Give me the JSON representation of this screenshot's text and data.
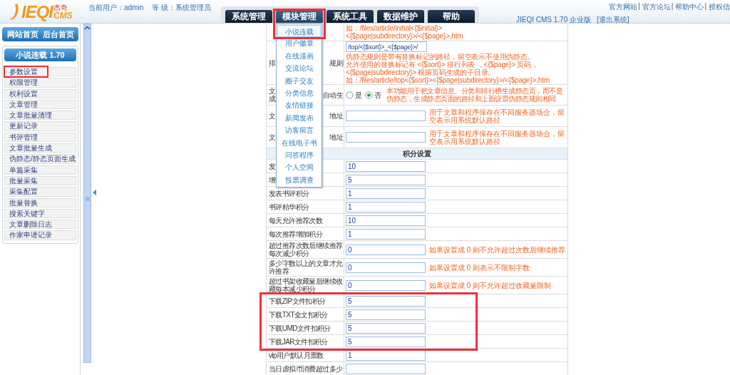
{
  "header": {
    "logo": {
      "text": "IEQI",
      "badge": "杰奇",
      "sub": "CMS"
    },
    "user": "当前用户：admin",
    "level": "等 级：系统管理员",
    "tabs": [
      {
        "label": "系统管理",
        "selected": false
      },
      {
        "label": "模块管理",
        "selected": true
      },
      {
        "label": "系统工具",
        "selected": false
      },
      {
        "label": "数据维护",
        "selected": false
      },
      {
        "label": "帮助",
        "selected": false
      }
    ],
    "links": [
      {
        "text": "官方网站",
        "sep": "|"
      },
      {
        "text": "官方论坛",
        "sep": "|"
      },
      {
        "text": "帮助中心",
        "sep": "|"
      },
      {
        "text": "授权信"
      }
    ],
    "version": "JIEQI CMS 1.70 企业版",
    "logout": "[退出系统]"
  },
  "sidebar": {
    "home_links": [
      "网站首页",
      "后台首页"
    ],
    "module_title": "小说连载 1.70",
    "items": [
      "参数设置",
      "权限管理",
      "权利设置",
      "文章管理",
      "文章批量清理",
      "更新记录",
      "书评管理",
      "文章批量生成",
      "伪静态/静态页面生成",
      "单篇采集",
      "批量采集",
      "采集配置",
      "批量替换",
      "搜索关键字",
      "文章删除日志",
      "作家申请记录"
    ]
  },
  "menu": {
    "items": [
      {
        "label": "小说连载",
        "selected": true
      },
      {
        "label": "用户徽章",
        "selected": false
      },
      {
        "label": "在线漫画",
        "selected": false
      },
      {
        "label": "交流论坛",
        "selected": false
      },
      {
        "label": "圈子交友",
        "selected": false
      },
      {
        "label": "分类信息",
        "selected": false
      },
      {
        "label": "友情链接",
        "selected": false
      },
      {
        "label": "新闻发布",
        "selected": false
      },
      {
        "label": "访客留言",
        "selected": false
      },
      {
        "label": "在线电子书",
        "selected": false
      },
      {
        "label": "问答程序",
        "selected": false
      },
      {
        "label": "个人空间",
        "selected": false
      },
      {
        "label": "投票调查",
        "selected": false
      }
    ]
  },
  "form": {
    "rows": [
      {
        "kind": "text",
        "help_lines": [
          "如：/files/article/initial<{$initial}>",
          "<{$page|subdirectory}>/<{$page}>.htm"
        ]
      },
      {
        "kind": "input_block",
        "label_parts": [
          "排",
          "规则"
        ],
        "value": "/top/<{$sort}>_<{$page}>/",
        "help_lines": [
          "伪静态规则是带有替换标记的路径，留空表示不使用伪静态。",
          "允许使用的替换标记有 <{$sort}> 排行列表 ，<{$page}> 页码，",
          "<{$page|subdirectory}> 根据页码生成的子目录。",
          "如：/files/article/top<{$sort}><{$page|subdirectory}>/<{$page}>.htm"
        ]
      },
      {
        "kind": "radio",
        "label_parts": [
          "文成",
          "自动生"
        ],
        "options": [
          {
            "label": "是",
            "selected": false
          },
          {
            "label": "否",
            "selected": true
          }
        ],
        "help": "本功能用于把文章信息、分类和排行榜生成静态页，而不是伪静态，生成静态页面的路径和上面设置伪静态规则相同"
      },
      {
        "kind": "input",
        "label_parts": [
          "文",
          "地址"
        ],
        "help": "用于文章和程序保存在不同服务器场合，留空表示用系统默认路径"
      },
      {
        "kind": "input",
        "label_parts": [
          "文",
          "地址"
        ],
        "help": "用于文章和程序保存在不同服务器场合，留空表示用系统默认路径"
      },
      {
        "kind": "section",
        "title": "积分设置"
      },
      {
        "kind": "input",
        "label_parts": [
          "发"
        ],
        "value": "10"
      },
      {
        "kind": "input",
        "label_parts": [
          "增"
        ],
        "value": "5"
      },
      {
        "kind": "input",
        "label": "发表书评积分",
        "value": "1"
      },
      {
        "kind": "input",
        "label": "书评精华积分",
        "value": "1"
      },
      {
        "kind": "input",
        "label": "每天允许推荐次数",
        "value": "10"
      },
      {
        "kind": "input",
        "label": "每次推荐增加积分",
        "value": "1"
      },
      {
        "kind": "input",
        "label": "超过推荐次数后继续推荐每次减少积分",
        "value": "0",
        "help": "如果设置成 0 则不允许超过次数后继续推荐"
      },
      {
        "kind": "input",
        "label": "多少字数以上的文章才允许推荐",
        "value": "0",
        "help": "如果设置成 0 则表示不限制字数"
      },
      {
        "kind": "input",
        "label": "超过书架收藏量后继续收藏每本减少积分",
        "value": "0",
        "help": "如果设置成 0 则不允许超过收藏量限制"
      },
      {
        "kind": "input",
        "label": "下载ZIP文件扣积分",
        "value": "5"
      },
      {
        "kind": "input",
        "label": "下载TXT全文扣积分",
        "value": "5"
      },
      {
        "kind": "input",
        "label": "下载UMD文件扣积分",
        "value": "5"
      },
      {
        "kind": "input",
        "label": "下载JAR文件扣积分",
        "value": "5"
      },
      {
        "kind": "input",
        "label": "vip用户默认月票数",
        "value": "1"
      },
      {
        "kind": "input",
        "label": "当日虚拟币消费超过多少"
      }
    ]
  }
}
